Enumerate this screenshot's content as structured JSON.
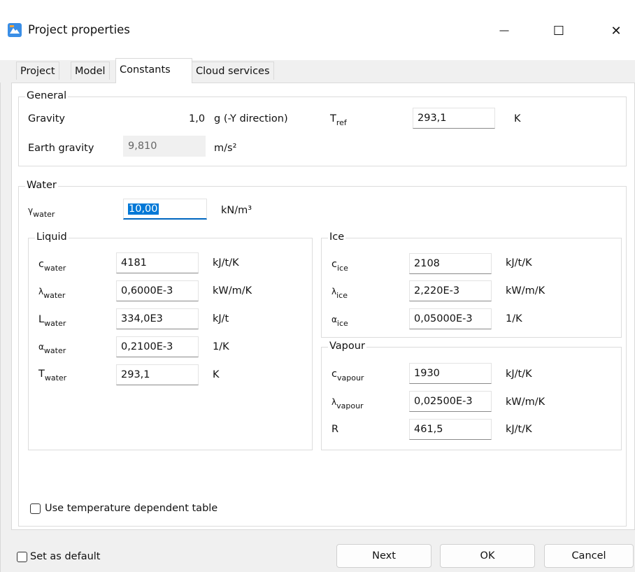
{
  "window": {
    "title": "Project properties",
    "controls": {
      "minimize": "—",
      "maximize": "☐",
      "close": "✕"
    }
  },
  "tabs": [
    {
      "label": "Project"
    },
    {
      "label": "Model"
    },
    {
      "label": "Constants"
    },
    {
      "label": "Cloud services"
    }
  ],
  "general": {
    "legend": "General",
    "gravity": {
      "label": "Gravity",
      "value": "1,0",
      "unit": "g (-Y direction)"
    },
    "tref": {
      "label": "T",
      "sub": "ref",
      "value": "293,1",
      "unit": "K"
    },
    "earth_gravity": {
      "label": "Earth gravity",
      "value": "9,810",
      "unit": "m/s²"
    }
  },
  "water": {
    "legend": "Water",
    "gamma": {
      "label": "γ",
      "sub": "water",
      "value": "10,00",
      "unit": "kN/m³"
    },
    "liquid": {
      "legend": "Liquid",
      "rows": [
        {
          "sym": "c",
          "sub": "water",
          "value": "4181",
          "unit": "kJ/t/K"
        },
        {
          "sym": "λ",
          "sub": "water",
          "value": "0,6000E-3",
          "unit": "kW/m/K"
        },
        {
          "sym": "L",
          "sub": "water",
          "value": "334,0E3",
          "unit": "kJ/t"
        },
        {
          "sym": "α",
          "sub": "water",
          "value": "0,2100E-3",
          "unit": "1/K"
        },
        {
          "sym": "T",
          "sub": "water",
          "value": "293,1",
          "unit": "K"
        }
      ]
    },
    "ice": {
      "legend": "Ice",
      "rows": [
        {
          "sym": "c",
          "sub": "ice",
          "value": "2108",
          "unit": "kJ/t/K"
        },
        {
          "sym": "λ",
          "sub": "ice",
          "value": "2,220E-3",
          "unit": "kW/m/K"
        },
        {
          "sym": "α",
          "sub": "ice",
          "value": "0,05000E-3",
          "unit": "1/K"
        }
      ]
    },
    "vapour": {
      "legend": "Vapour",
      "rows": [
        {
          "sym": "c",
          "sub": "vapour",
          "value": "1930",
          "unit": "kJ/t/K"
        },
        {
          "sym": "λ",
          "sub": "vapour",
          "value": "0,02500E-3",
          "unit": "kW/m/K"
        },
        {
          "sym": "R",
          "sub": "",
          "value": "461,5",
          "unit": "kJ/t/K"
        }
      ]
    },
    "temp_table_label": "Use temperature dependent table"
  },
  "footer": {
    "set_default_label": "Set as default",
    "next_label": "Next",
    "ok_label": "OK",
    "cancel_label": "Cancel"
  }
}
